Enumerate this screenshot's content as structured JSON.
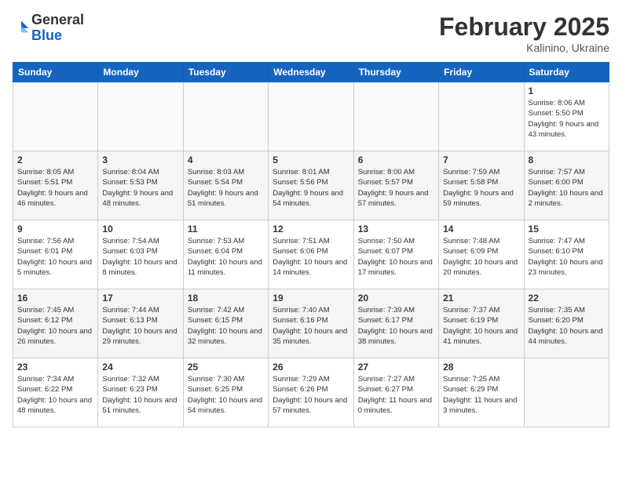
{
  "header": {
    "logo_general": "General",
    "logo_blue": "Blue",
    "month_title": "February 2025",
    "subtitle": "Kalinino, Ukraine"
  },
  "weekdays": [
    "Sunday",
    "Monday",
    "Tuesday",
    "Wednesday",
    "Thursday",
    "Friday",
    "Saturday"
  ],
  "weeks": [
    [
      {
        "day": "",
        "info": ""
      },
      {
        "day": "",
        "info": ""
      },
      {
        "day": "",
        "info": ""
      },
      {
        "day": "",
        "info": ""
      },
      {
        "day": "",
        "info": ""
      },
      {
        "day": "",
        "info": ""
      },
      {
        "day": "1",
        "info": "Sunrise: 8:06 AM\nSunset: 5:50 PM\nDaylight: 9 hours and 43 minutes."
      }
    ],
    [
      {
        "day": "2",
        "info": "Sunrise: 8:05 AM\nSunset: 5:51 PM\nDaylight: 9 hours and 46 minutes."
      },
      {
        "day": "3",
        "info": "Sunrise: 8:04 AM\nSunset: 5:53 PM\nDaylight: 9 hours and 48 minutes."
      },
      {
        "day": "4",
        "info": "Sunrise: 8:03 AM\nSunset: 5:54 PM\nDaylight: 9 hours and 51 minutes."
      },
      {
        "day": "5",
        "info": "Sunrise: 8:01 AM\nSunset: 5:56 PM\nDaylight: 9 hours and 54 minutes."
      },
      {
        "day": "6",
        "info": "Sunrise: 8:00 AM\nSunset: 5:57 PM\nDaylight: 9 hours and 57 minutes."
      },
      {
        "day": "7",
        "info": "Sunrise: 7:59 AM\nSunset: 5:58 PM\nDaylight: 9 hours and 59 minutes."
      },
      {
        "day": "8",
        "info": "Sunrise: 7:57 AM\nSunset: 6:00 PM\nDaylight: 10 hours and 2 minutes."
      }
    ],
    [
      {
        "day": "9",
        "info": "Sunrise: 7:56 AM\nSunset: 6:01 PM\nDaylight: 10 hours and 5 minutes."
      },
      {
        "day": "10",
        "info": "Sunrise: 7:54 AM\nSunset: 6:03 PM\nDaylight: 10 hours and 8 minutes."
      },
      {
        "day": "11",
        "info": "Sunrise: 7:53 AM\nSunset: 6:04 PM\nDaylight: 10 hours and 11 minutes."
      },
      {
        "day": "12",
        "info": "Sunrise: 7:51 AM\nSunset: 6:06 PM\nDaylight: 10 hours and 14 minutes."
      },
      {
        "day": "13",
        "info": "Sunrise: 7:50 AM\nSunset: 6:07 PM\nDaylight: 10 hours and 17 minutes."
      },
      {
        "day": "14",
        "info": "Sunrise: 7:48 AM\nSunset: 6:09 PM\nDaylight: 10 hours and 20 minutes."
      },
      {
        "day": "15",
        "info": "Sunrise: 7:47 AM\nSunset: 6:10 PM\nDaylight: 10 hours and 23 minutes."
      }
    ],
    [
      {
        "day": "16",
        "info": "Sunrise: 7:45 AM\nSunset: 6:12 PM\nDaylight: 10 hours and 26 minutes."
      },
      {
        "day": "17",
        "info": "Sunrise: 7:44 AM\nSunset: 6:13 PM\nDaylight: 10 hours and 29 minutes."
      },
      {
        "day": "18",
        "info": "Sunrise: 7:42 AM\nSunset: 6:15 PM\nDaylight: 10 hours and 32 minutes."
      },
      {
        "day": "19",
        "info": "Sunrise: 7:40 AM\nSunset: 6:16 PM\nDaylight: 10 hours and 35 minutes."
      },
      {
        "day": "20",
        "info": "Sunrise: 7:39 AM\nSunset: 6:17 PM\nDaylight: 10 hours and 38 minutes."
      },
      {
        "day": "21",
        "info": "Sunrise: 7:37 AM\nSunset: 6:19 PM\nDaylight: 10 hours and 41 minutes."
      },
      {
        "day": "22",
        "info": "Sunrise: 7:35 AM\nSunset: 6:20 PM\nDaylight: 10 hours and 44 minutes."
      }
    ],
    [
      {
        "day": "23",
        "info": "Sunrise: 7:34 AM\nSunset: 6:22 PM\nDaylight: 10 hours and 48 minutes."
      },
      {
        "day": "24",
        "info": "Sunrise: 7:32 AM\nSunset: 6:23 PM\nDaylight: 10 hours and 51 minutes."
      },
      {
        "day": "25",
        "info": "Sunrise: 7:30 AM\nSunset: 6:25 PM\nDaylight: 10 hours and 54 minutes."
      },
      {
        "day": "26",
        "info": "Sunrise: 7:29 AM\nSunset: 6:26 PM\nDaylight: 10 hours and 57 minutes."
      },
      {
        "day": "27",
        "info": "Sunrise: 7:27 AM\nSunset: 6:27 PM\nDaylight: 11 hours and 0 minutes."
      },
      {
        "day": "28",
        "info": "Sunrise: 7:25 AM\nSunset: 6:29 PM\nDaylight: 11 hours and 3 minutes."
      },
      {
        "day": "",
        "info": ""
      }
    ]
  ]
}
